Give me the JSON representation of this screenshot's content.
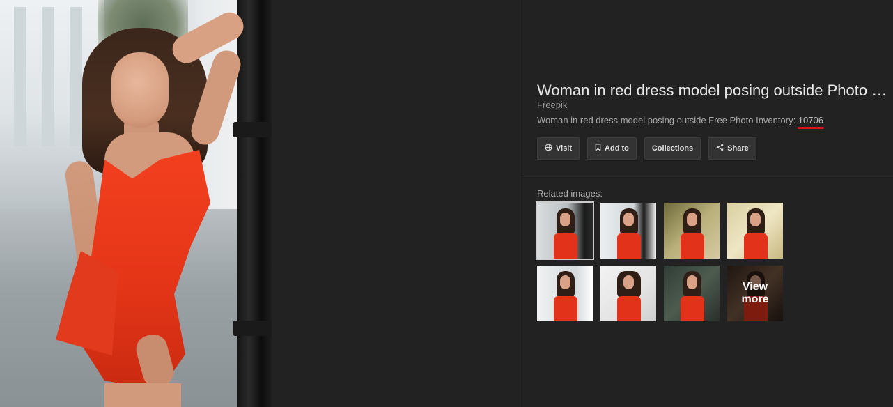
{
  "panel": {
    "title": "Woman in red dress model posing outside Photo …",
    "source": "Freepik",
    "description": "Woman in red dress model posing outside Free Photo Inventory: ",
    "inventory_number": "10706",
    "actions": [
      {
        "label": "Visit",
        "icon": "globe-icon"
      },
      {
        "label": "Add to",
        "icon": "bookmark-icon"
      },
      {
        "label": "Collections",
        "icon": ""
      },
      {
        "label": "Share",
        "icon": "share-icon"
      }
    ],
    "related_label": "Related images:",
    "view_more_label": "View more"
  },
  "colors": {
    "background": "#222222",
    "button_bg": "#333333",
    "underline": "#d9141b",
    "dress_red": "#e53518"
  }
}
